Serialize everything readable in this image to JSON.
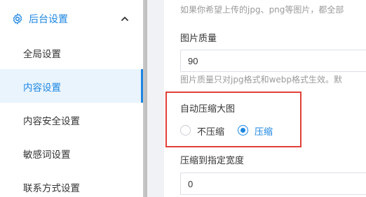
{
  "sidebar": {
    "group_title": "后台设置",
    "items": [
      {
        "label": "全局设置",
        "active": false
      },
      {
        "label": "内容设置",
        "active": true
      },
      {
        "label": "内容安全设置",
        "active": false
      },
      {
        "label": "敏感词设置",
        "active": false
      },
      {
        "label": "联系方式设置",
        "active": false
      }
    ]
  },
  "content": {
    "top_hint": "如果你希望上传的jpg、png等图片，都全部",
    "image_quality": {
      "label": "图片质量",
      "value": "90",
      "hint": "图片质量只对jpg格式和webp格式生效。默"
    },
    "auto_compress": {
      "label": "自动压缩大图",
      "options": [
        {
          "label": "不压缩",
          "checked": false
        },
        {
          "label": "压缩",
          "checked": true
        }
      ]
    },
    "compress_width": {
      "label": "压缩到指定宽度",
      "value": "0"
    }
  },
  "colors": {
    "accent": "#1c86e2",
    "highlight": "#e0403a"
  }
}
